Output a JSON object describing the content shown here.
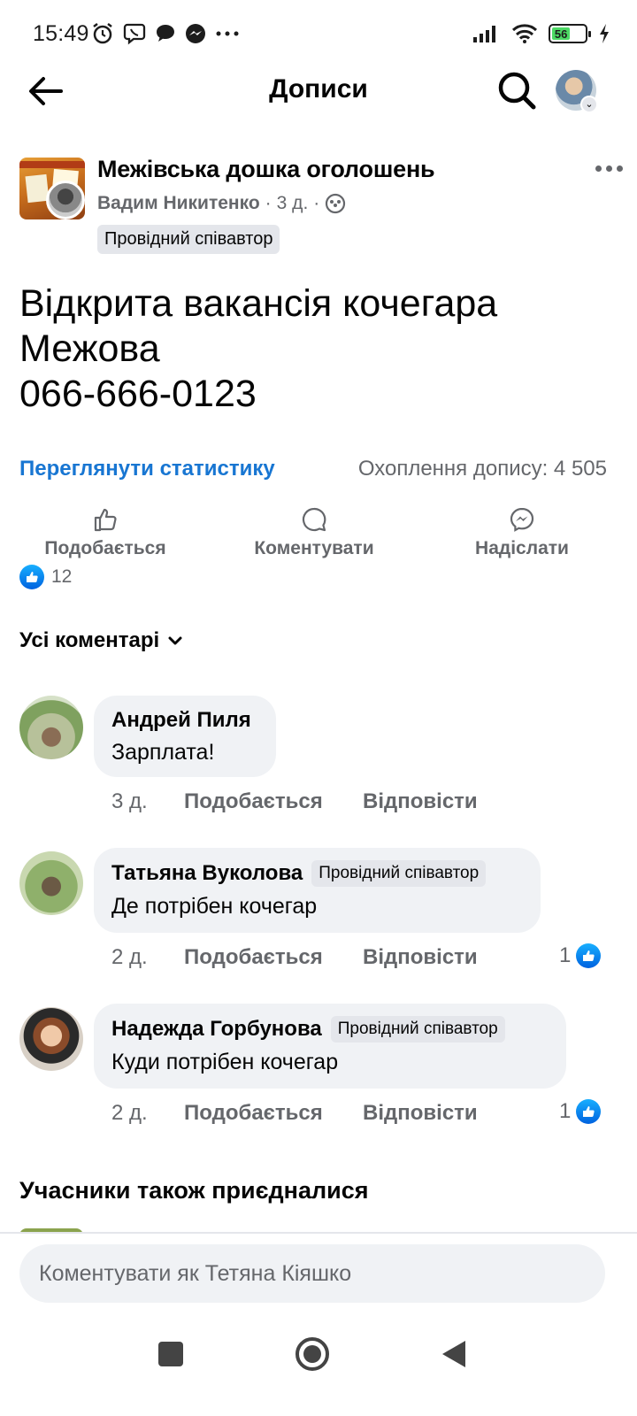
{
  "status_bar": {
    "time": "15:49",
    "battery_level": "56",
    "icons_left": [
      "alarm-icon",
      "viber-icon",
      "chat-icon",
      "messenger-icon",
      "more-dots-icon"
    ],
    "icons_right": [
      "signal-icon",
      "wifi-icon",
      "battery-icon",
      "charging-icon"
    ]
  },
  "header": {
    "title": "Дописи"
  },
  "post": {
    "group_name": "Межівська дошка оголошень",
    "author": "Вадим Никитенко",
    "time": "3 д.",
    "meta_separator": "·",
    "author_badge": "Провідний співавтор",
    "text_lines": [
      "Відкрита вакансія кочегара",
      "Межова",
      "066-666-0123"
    ],
    "view_stats_label": "Переглянути статистику",
    "reach_label": "Охоплення допису: 4 505",
    "actions": {
      "like": "Подобається",
      "comment": "Коментувати",
      "send": "Надіслати"
    },
    "reaction_count": "12"
  },
  "comments_section": {
    "filter_label": "Усі коментарі",
    "comments": [
      {
        "author": "Андрей Пиля",
        "badge": "",
        "text": "Зарплата!",
        "time": "3 д.",
        "like_label": "Подобається",
        "reply_label": "Відповісти",
        "reactions": ""
      },
      {
        "author": "Татьяна Вуколова",
        "badge": "Провідний співавтор",
        "text": "Де потрібен кочегар",
        "time": "2 д.",
        "like_label": "Подобається",
        "reply_label": "Відповісти",
        "reactions": "1"
      },
      {
        "author": "Надежда Горбунова",
        "badge": "Провідний співавтор",
        "text": "Куди потрібен кочегар",
        "time": "2 д.",
        "like_label": "Подобається",
        "reply_label": "Відповісти",
        "reactions": "1"
      }
    ],
    "also_joined_heading": "Учасники також приєдналися"
  },
  "composer": {
    "placeholder": "Коментувати як Тетяна Кіяшко"
  },
  "colors": {
    "accent_blue": "#1876d2",
    "secondary_text": "#65676b",
    "bubble_bg": "#f0f2f5"
  }
}
